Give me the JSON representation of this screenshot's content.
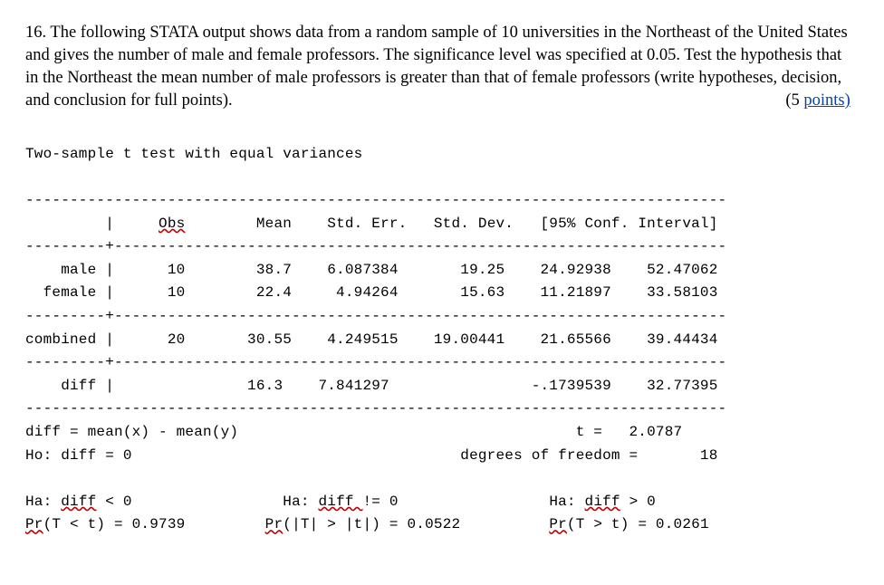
{
  "question": {
    "number": "16.",
    "body_1": "The following STATA output shows data from a random sample of 10 universities in the Northeast of the United States and gives the number of male and female professors. The significance level was specified at 0.05. Test the hypothesis that in the Northeast the mean number of male professors is greater than that of female professors (write hypotheses, decision, and conclusion for full points).",
    "points_prefix": "(5 ",
    "points_link": "points)"
  },
  "output": {
    "title": "Two-sample t test with equal variances",
    "hr1": "-------------------------------------------------------------------------------",
    "head": "         |     ",
    "header_obs": "Obs",
    "header_rest": "        Mean    Std. Err.   Std. Dev.   [95% Conf. Interval]",
    "hr2": "---------+---------------------------------------------------------------------",
    "row_male": "    male |      10        38.7    6.087384       19.25    24.92938    52.47062",
    "row_female": "  female |      10        22.4     4.94264       15.63    11.21897    33.58103",
    "hr3": "---------+---------------------------------------------------------------------",
    "row_comb": "combined |      20       30.55    4.249515    19.00441    21.65566    39.44434",
    "hr4": "---------+---------------------------------------------------------------------",
    "row_diff": "    diff |               16.3    7.841297                -.1739539    32.77395",
    "hr5": "-------------------------------------------------------------------------------",
    "diff_expr": "diff = mean(x) - mean(y)                                      t =   2.0787",
    "ho": "Ho: diff = 0                                     degrees of freedom =       18",
    "blank": "",
    "ha_row_pre1": "Ha: ",
    "ha_diff1": "diff",
    "ha_row_mid1": " < 0                 Ha: ",
    "ha_diff2": "diff ",
    "ha_row_mid2": "!= 0                 Ha: ",
    "ha_diff3": "diff",
    "ha_row_end": " > 0",
    "pr_pre1": "Pr",
    "pr_mid1": "(T < t) = 0.9739         ",
    "pr_pre2": "Pr",
    "pr_mid2": "(|T| > |t|) = 0.0522          ",
    "pr_pre3": "Pr",
    "pr_end": "(T > t) = 0.0261"
  }
}
